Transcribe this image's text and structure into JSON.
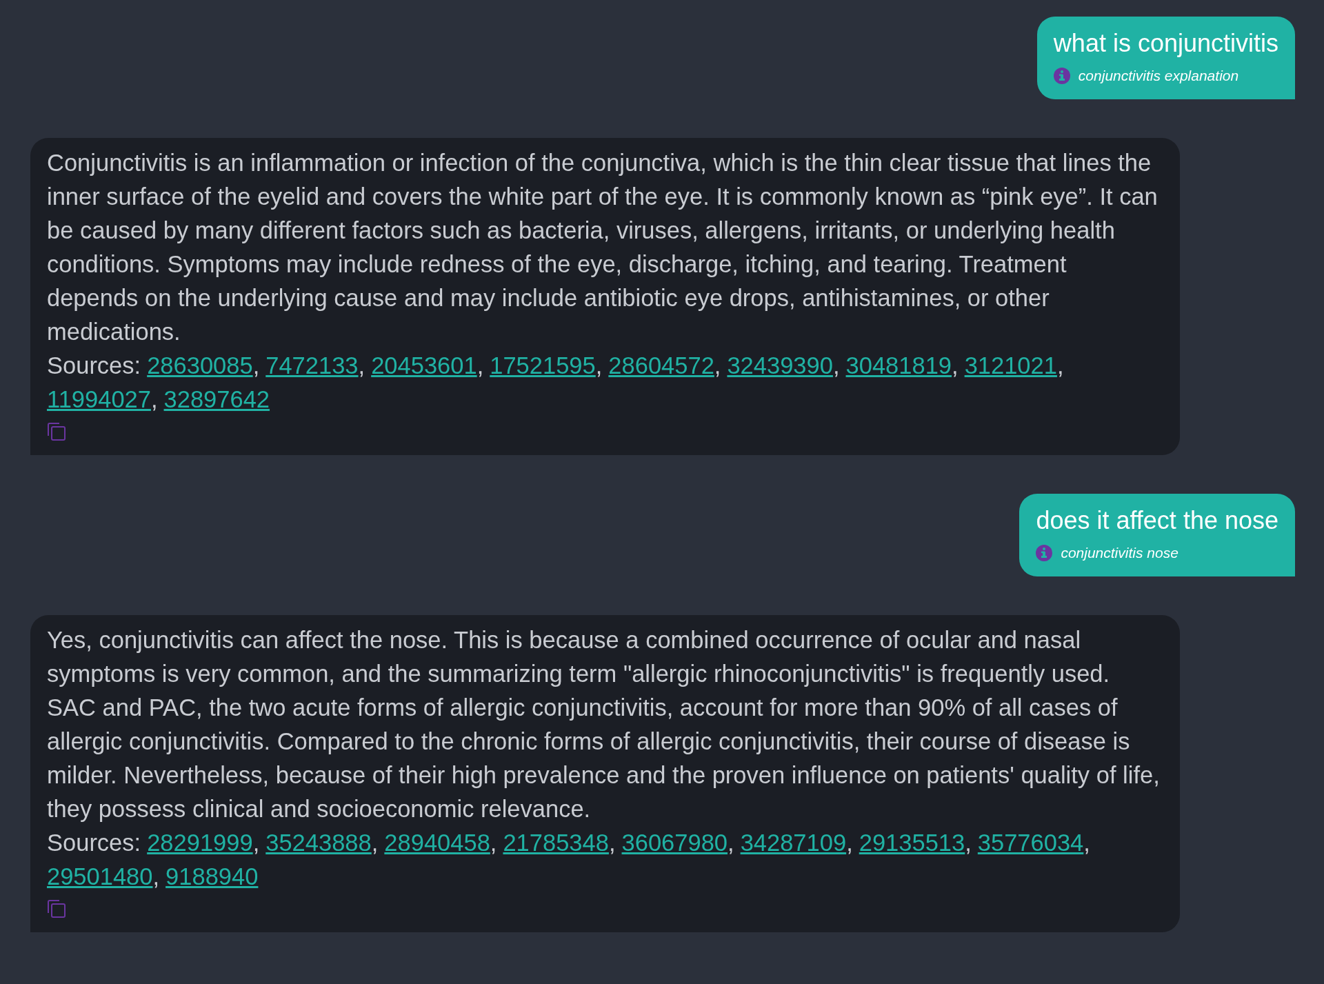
{
  "messages": [
    {
      "kind": "user",
      "text": "what is conjunctivitis",
      "query": "conjunctivitis explanation"
    },
    {
      "kind": "bot",
      "text": "Conjunctivitis is an inflammation or infection of the conjunctiva, which is the thin clear tissue that lines the inner surface of the eyelid and covers the white part of the eye. It is commonly known as “pink eye”. It can be caused by many different factors such as bacteria, viruses, allergens, irritants, or underlying health conditions. Symptoms may include redness of the eye, discharge, itching, and tearing. Treatment depends on the underlying cause and may include antibiotic eye drops, antihistamines, or other medications.",
      "sources_label": "Sources:",
      "sources": [
        {
          "id": "28630085",
          "sep": ","
        },
        {
          "id": "7472133",
          "sep": ","
        },
        {
          "id": "20453601",
          "sep": ","
        },
        {
          "id": "17521595",
          "sep": ","
        },
        {
          "id": "28604572",
          "sep": ","
        },
        {
          "id": "32439390",
          "sep": ","
        },
        {
          "id": "30481819",
          "sep": ","
        },
        {
          "id": "3121021",
          "sep": ","
        },
        {
          "id": "11994027",
          "sep": ","
        },
        {
          "id": "32897642"
        }
      ]
    },
    {
      "kind": "user",
      "text": "does it affect the nose",
      "query": "conjunctivitis nose"
    },
    {
      "kind": "bot",
      "text": "Yes, conjunctivitis can affect the nose. This is because a combined occurrence of ocular and nasal symptoms is very common, and the summarizing term \"allergic rhinoconjunctivitis\" is frequently used. SAC and PAC, the two acute forms of allergic conjunctivitis, account for more than 90% of all cases of allergic conjunctivitis. Compared to the chronic forms of allergic conjunctivitis, their course of disease is milder. Nevertheless, because of their high prevalence and the proven influence on patients' quality of life, they possess clinical and socioeconomic relevance.",
      "sources_label": "Sources:",
      "sources": [
        {
          "id": "28291999",
          "sep": ","
        },
        {
          "id": "35243888",
          "sep": ","
        },
        {
          "id": "28940458",
          "sep": ","
        },
        {
          "id": "21785348",
          "sep": ","
        },
        {
          "id": "36067980",
          "sep": ","
        },
        {
          "id": "34287109",
          "sep": ","
        },
        {
          "id": "29135513",
          "sep": ","
        },
        {
          "id": "35776034",
          "sep": ","
        },
        {
          "id": "29501480",
          "sep": ","
        },
        {
          "id": "9188940"
        }
      ]
    }
  ]
}
